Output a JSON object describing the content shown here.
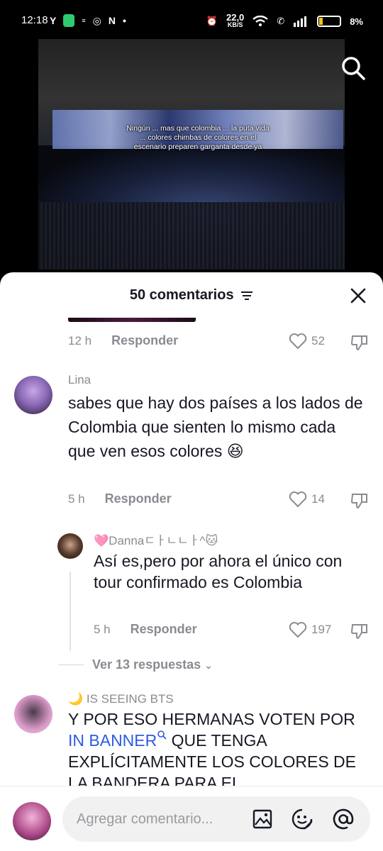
{
  "status_bar": {
    "time": "12:18",
    "net_speed_value": "22,0",
    "net_speed_unit": "KB/S",
    "battery": "8%"
  },
  "video": {
    "caption": "Ningún ... mas que colombia ... la puta vida ... colores chimbas de colores en el escenario preparen garganta desde ya"
  },
  "comments_panel": {
    "title": "50 comentarios",
    "reply_label": "Responder",
    "view_replies_label": "Ver 13 respuestas",
    "input_placeholder": "Agregar comentario...",
    "comments": [
      {
        "time": "12 h",
        "likes": "52"
      },
      {
        "username": "Lina",
        "text": "sabes que hay dos países a los lados de Colombia que sienten lo mismo cada que ven esos colores 😆",
        "time": "5 h",
        "likes": "14"
      },
      {
        "username": "🩷Dannaㄷㅏㄴㄴㅏ^🐱",
        "text": "Así es,pero por ahora el único con tour confirmado es Colombia",
        "time": "5 h",
        "likes": "197"
      },
      {
        "username": "🌙 IS SEEING BTS",
        "text_before": "Y POR ESO HERMANAS VOTEN POR ",
        "link_text": "IN BANNER",
        "text_after": " QUE TENGA EXPLÍCITAMENTE LOS COLORES DE LA BANDERA PARA EL"
      }
    ]
  },
  "colors": {
    "text_primary": "#161823",
    "text_secondary": "#8a8b91",
    "link": "#2d5be3"
  }
}
